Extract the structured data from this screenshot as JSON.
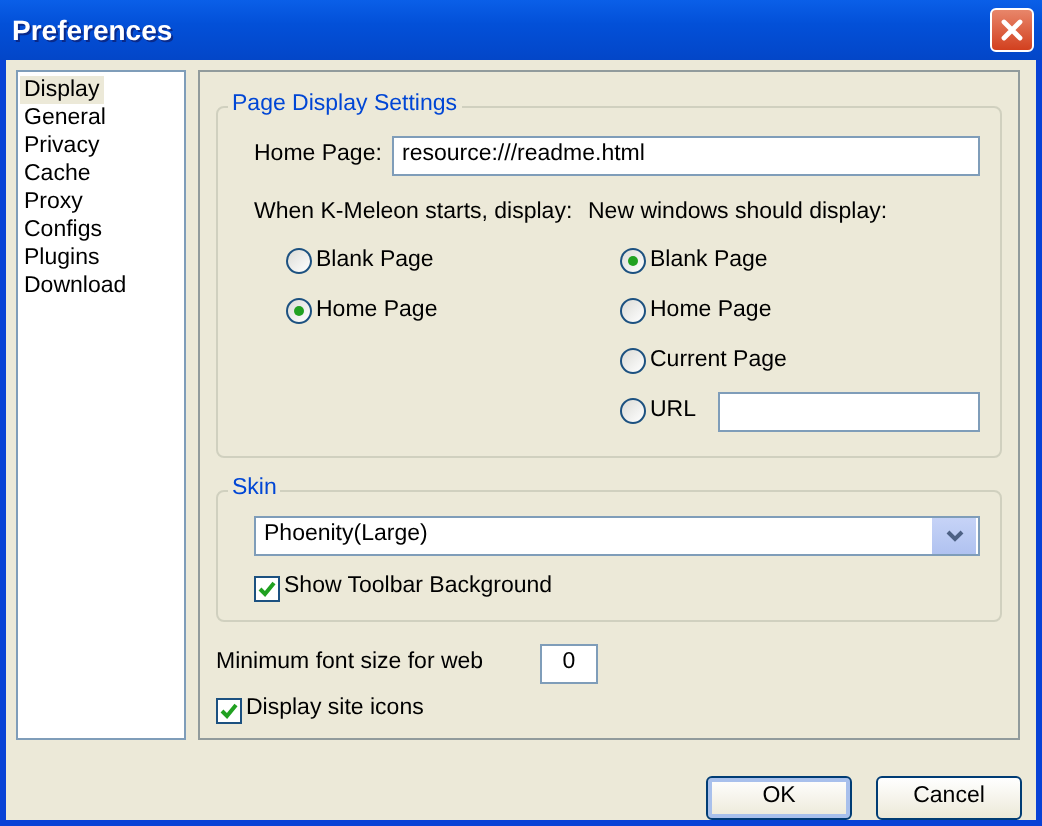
{
  "window": {
    "title": "Preferences"
  },
  "sidebar": {
    "items": [
      {
        "label": "Display",
        "selected": true
      },
      {
        "label": "General",
        "selected": false
      },
      {
        "label": "Privacy",
        "selected": false
      },
      {
        "label": "Cache",
        "selected": false
      },
      {
        "label": "Proxy",
        "selected": false
      },
      {
        "label": "Configs",
        "selected": false
      },
      {
        "label": "Plugins",
        "selected": false
      },
      {
        "label": "Download",
        "selected": false
      }
    ]
  },
  "page_display_settings": {
    "title": "Page Display Settings",
    "home_page": {
      "label": "Home Page:",
      "value": "resource:///readme.html"
    },
    "startup": {
      "label": "When K-Meleon starts, display:",
      "options": [
        {
          "label": "Blank Page",
          "selected": false
        },
        {
          "label": "Home Page",
          "selected": true
        }
      ]
    },
    "new_windows": {
      "label": "New windows should display:",
      "options": [
        {
          "label": "Blank Page",
          "selected": true,
          "kind": "plain"
        },
        {
          "label": "Home Page",
          "selected": false,
          "kind": "plain"
        },
        {
          "label": "Current Page",
          "selected": false,
          "kind": "plain"
        },
        {
          "label": "URL",
          "selected": false,
          "kind": "url"
        }
      ]
    }
  },
  "skin": {
    "title": "Skin",
    "value": "Phoenity(Large)",
    "show_toolbar_background": {
      "label": "Show Toolbar Background",
      "checked": true
    }
  },
  "min_font": {
    "label": "Minimum font size for web",
    "value": "0"
  },
  "display_site_icons": {
    "label": "Display site icons",
    "checked": true
  },
  "buttons": [
    {
      "label": "OK",
      "default": true
    },
    {
      "label": "Cancel",
      "default": false
    }
  ]
}
